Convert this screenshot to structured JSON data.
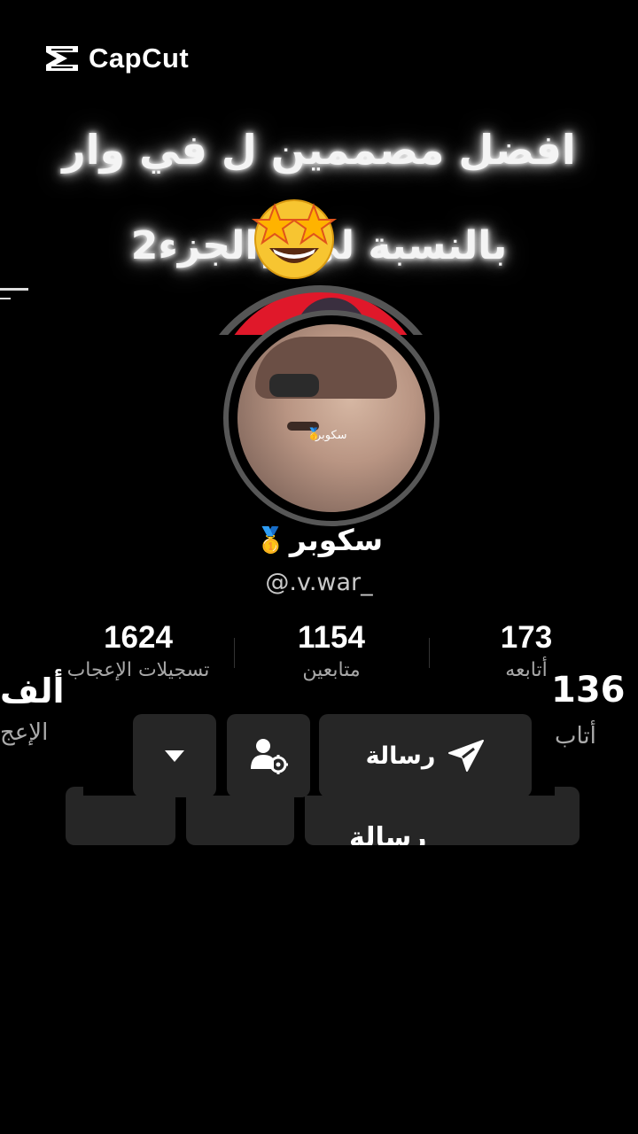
{
  "watermark": {
    "brand": "CapCut"
  },
  "caption": {
    "line1": "افضل مصممين ل في وار",
    "line2": "بالنسبة لي ||الجزء2",
    "emoji": "🤩"
  },
  "profile": {
    "display_name": "سكوبر",
    "badge_emoji": "🥇",
    "username": "@.v.war_",
    "avatar_overlay_text": "سكوبر"
  },
  "stats": [
    {
      "value": "173",
      "label": "أتابعه"
    },
    {
      "value": "1154",
      "label": "متابعين"
    },
    {
      "value": "1624",
      "label": "تسجيلات الإعجاب"
    }
  ],
  "actions": {
    "message_label": "رسالة",
    "friends_icon": "user-gear-icon",
    "more_icon": "caret-down-icon"
  },
  "ghost": {
    "stat_left_value": "ألف",
    "stat_left_label": "الإعج",
    "stat_right_value": "136",
    "stat_right_label": "أتاب",
    "message_label": "رسالة"
  }
}
